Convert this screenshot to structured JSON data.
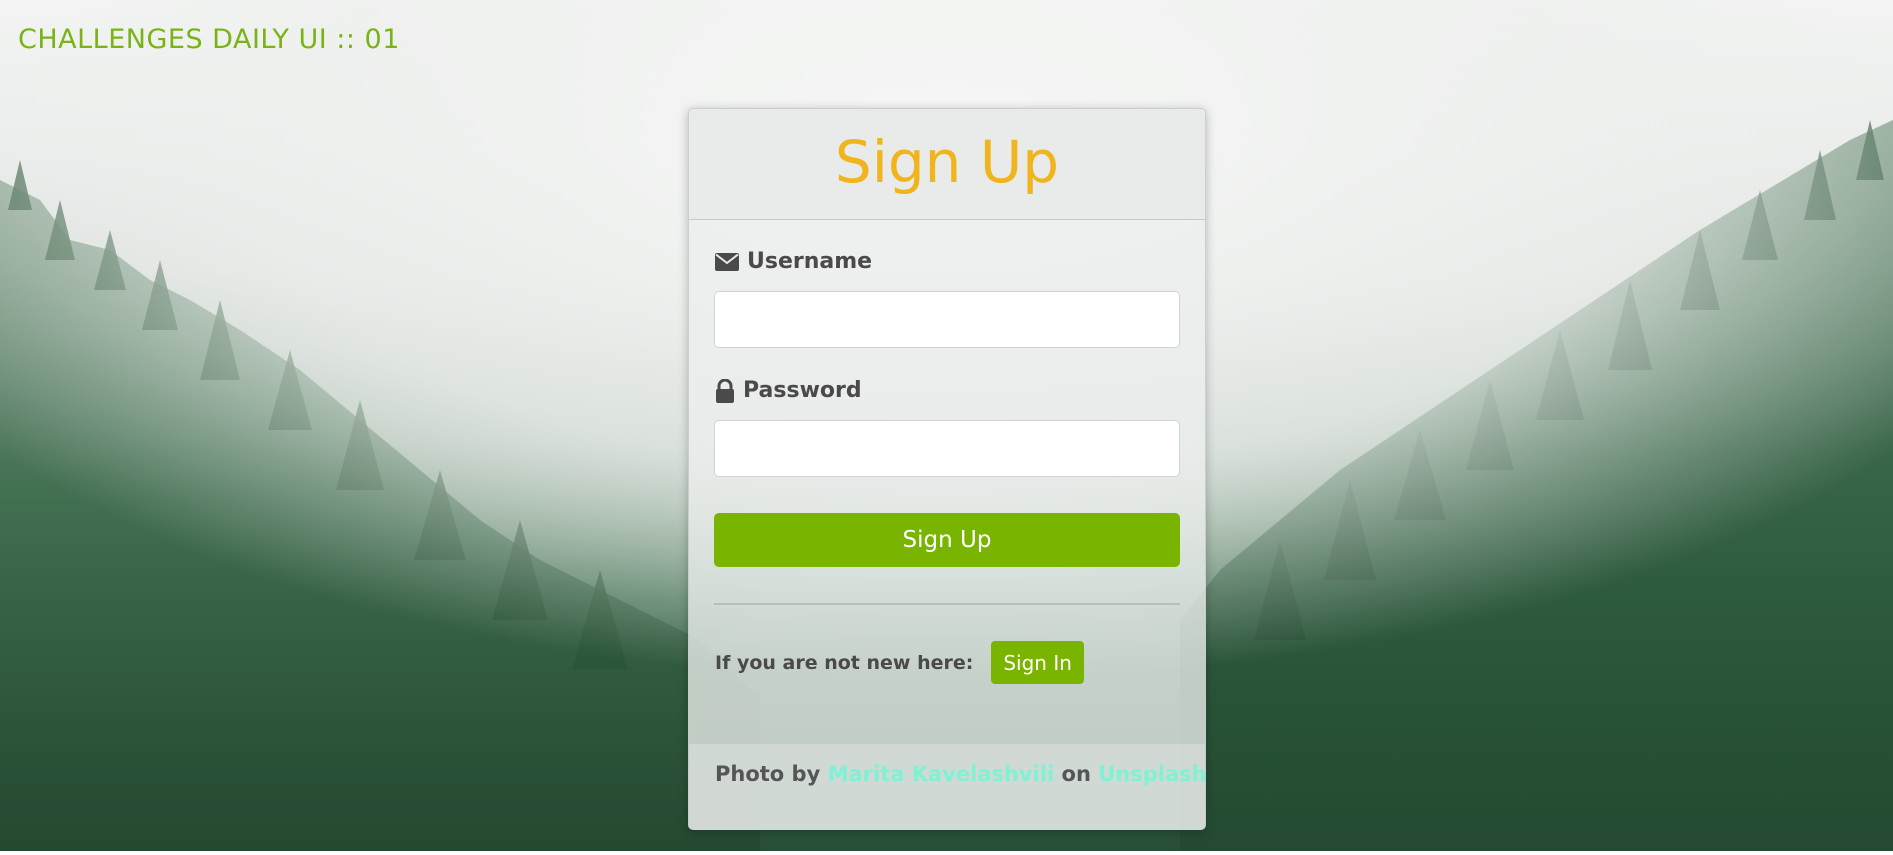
{
  "app": {
    "title": "CHALLENGES DAILY UI :: 01"
  },
  "form": {
    "title": "Sign Up",
    "username": {
      "label": "Username",
      "icon": "envelope-icon",
      "value": "",
      "placeholder": ""
    },
    "password": {
      "label": "Password",
      "icon": "lock-icon",
      "value": "",
      "placeholder": ""
    },
    "submit_label": "Sign Up",
    "signin_prompt": "If you are not new here:",
    "signin_label": "Sign In"
  },
  "credit": {
    "prefix": "Photo by",
    "author": "Marita Kavelashvili",
    "middle": "on",
    "source": "Unsplash"
  },
  "colors": {
    "accent_green": "#78b400",
    "title_green": "#7ab317",
    "title_gold": "#f0b41c",
    "link_mint": "#7ff1d4"
  }
}
